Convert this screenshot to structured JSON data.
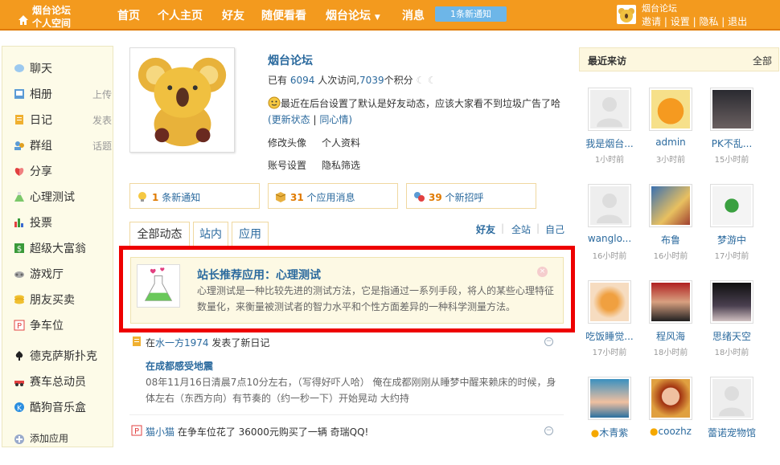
{
  "topbar": {
    "logo_line1": "烟台论坛",
    "logo_line2": "个人空间",
    "nav": [
      "首页",
      "个人主页",
      "好友",
      "随便看看",
      "烟台论坛",
      "消息"
    ],
    "dropdown_arrow": "▼",
    "notice": "1条新通知",
    "user_name": "烟台论坛",
    "user_links": [
      "邀请",
      "设置",
      "隐私",
      "退出"
    ],
    "separator": "|"
  },
  "sidebar": {
    "items": [
      {
        "label": "聊天",
        "extra": "",
        "icon": "chat-icon"
      },
      {
        "label": "相册",
        "extra": "上传",
        "icon": "album-icon"
      },
      {
        "label": "日记",
        "extra": "发表",
        "icon": "diary-icon"
      },
      {
        "label": "群组",
        "extra": "话题",
        "icon": "group-icon"
      },
      {
        "label": "分享",
        "extra": "",
        "icon": "share-icon"
      },
      {
        "label": "心理测试",
        "extra": "",
        "icon": "flask-icon"
      },
      {
        "label": "投票",
        "extra": "",
        "icon": "vote-icon"
      },
      {
        "label": "超级大富翁",
        "extra": "",
        "icon": "money-icon"
      },
      {
        "label": "游戏厅",
        "extra": "",
        "icon": "game-icon"
      },
      {
        "label": "朋友买卖",
        "extra": "",
        "icon": "coins-icon"
      },
      {
        "label": "争车位",
        "extra": "",
        "icon": "parking-icon"
      },
      {
        "label": "德克萨斯扑克",
        "extra": "",
        "icon": "poker-icon"
      },
      {
        "label": "赛车总动员",
        "extra": "",
        "icon": "car-icon"
      },
      {
        "label": "酷狗音乐盒",
        "extra": "",
        "icon": "music-icon"
      },
      {
        "label": "添加应用",
        "extra": "",
        "icon": "add-icon"
      }
    ]
  },
  "profile": {
    "name": "烟台论坛",
    "stats_prefix": "已有",
    "visits": "6094",
    "visits_label": "人次访问,",
    "points": "7039",
    "points_label": "个积分",
    "status": "最近在后台设置了默认是好友动态，应该大家看不到垃圾广告了哈",
    "status_update": "(更新状态",
    "status_sep": "|",
    "status_mood": "同心情)",
    "link_avatar": "修改头像",
    "link_profile": "个人资料",
    "link_account": "账号设置",
    "link_privacy": "隐私筛选"
  },
  "notices": [
    {
      "count": "1",
      "label": "条新通知",
      "icon": "bulb-icon"
    },
    {
      "count": "31",
      "label": "个应用消息",
      "icon": "box-icon"
    },
    {
      "count": "39",
      "label": "个新招呼",
      "icon": "greet-icon"
    }
  ],
  "tabs": [
    "全部动态",
    "站内",
    "应用"
  ],
  "filter_tabs": [
    "好友",
    "全站",
    "自己"
  ],
  "filter_sep": "|",
  "recommend": {
    "title_prefix": "站长推荐应用：",
    "title_app": "心理测试",
    "desc": "心理测试是一种比较先进的测试方法，它是指通过一系列手段，将人的某些心理特征数量化，来衡量被测试者的智力水平和个性方面差异的一种科学测量方法。",
    "close": "×"
  },
  "feed": [
    {
      "prefix": "在",
      "user": "水一方1974",
      "action": "发表了新日记",
      "entry_title": "在成都感受地震",
      "entry_body": "08年11月16日清晨7点10分左右，（写得好吓人哈） 俺在成都刚刚从睡梦中醒来赖床的时候，身体左右（东西方向）有节奏的（约一秒一下）开始晃动 大约持"
    },
    {
      "prefix": "",
      "user": "猫小猫",
      "action": "在争车位花了 36000元购买了一辆 奇瑞QQ!",
      "entry_title": "",
      "entry_body": ""
    }
  ],
  "minus": "−",
  "visitors": {
    "title": "最近来访",
    "all": "全部",
    "list": [
      {
        "name": "我是烟台...",
        "time": "1小时前"
      },
      {
        "name": "admin",
        "time": "3小时前"
      },
      {
        "name": "PK不乱...",
        "time": "15小时前"
      },
      {
        "name": "wanglo...",
        "time": "16小时前"
      },
      {
        "name": "布鲁",
        "time": "16小时前"
      },
      {
        "name": "梦游中",
        "time": "17小时前"
      },
      {
        "name": "吃饭睡觉...",
        "time": "17小时前"
      },
      {
        "name": "程风海",
        "time": "18小时前"
      },
      {
        "name": "思绪天空",
        "time": "18小时前"
      },
      {
        "name": "木青紫",
        "time": ""
      },
      {
        "name": "coozhz",
        "time": ""
      },
      {
        "name": "蕾诺宠物馆",
        "time": ""
      }
    ]
  }
}
